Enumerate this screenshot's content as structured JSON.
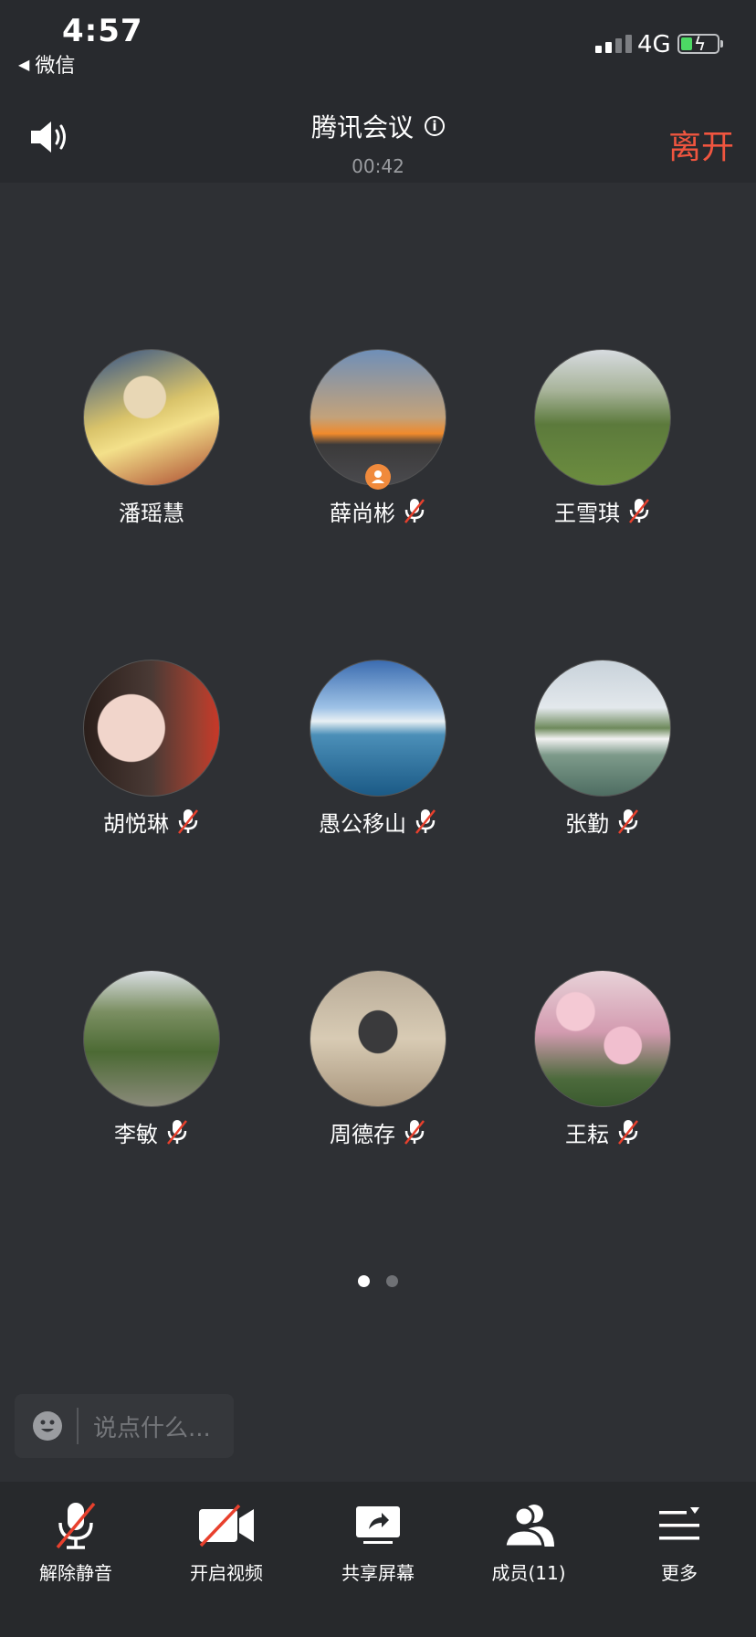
{
  "status_bar": {
    "time": "4:57",
    "back_label": "微信",
    "network": "4G"
  },
  "header": {
    "title": "腾讯会议",
    "timer": "00:42",
    "leave_label": "离开"
  },
  "participants": [
    {
      "name": "潘瑶慧",
      "muted": false,
      "host": false
    },
    {
      "name": "薛尚彬",
      "muted": true,
      "host": true
    },
    {
      "name": "王雪琪",
      "muted": true,
      "host": false
    },
    {
      "name": "胡悦琳",
      "muted": true,
      "host": false
    },
    {
      "name": "愚公移山",
      "muted": true,
      "host": false
    },
    {
      "name": "张勤",
      "muted": true,
      "host": false
    },
    {
      "name": "李敏",
      "muted": true,
      "host": false
    },
    {
      "name": "周德存",
      "muted": true,
      "host": false
    },
    {
      "name": "王耘",
      "muted": true,
      "host": false
    }
  ],
  "pager": {
    "pages": 2,
    "current": 1
  },
  "chat": {
    "placeholder": "说点什么..."
  },
  "toolbar": {
    "unmute_label": "解除静音",
    "video_label": "开启视频",
    "share_label": "共享屏幕",
    "members_label": "成员(11)",
    "more_label": "更多"
  },
  "colors": {
    "accent_red": "#f0553f",
    "battery_green": "#4cd964",
    "host_orange": "#f08a3c"
  }
}
